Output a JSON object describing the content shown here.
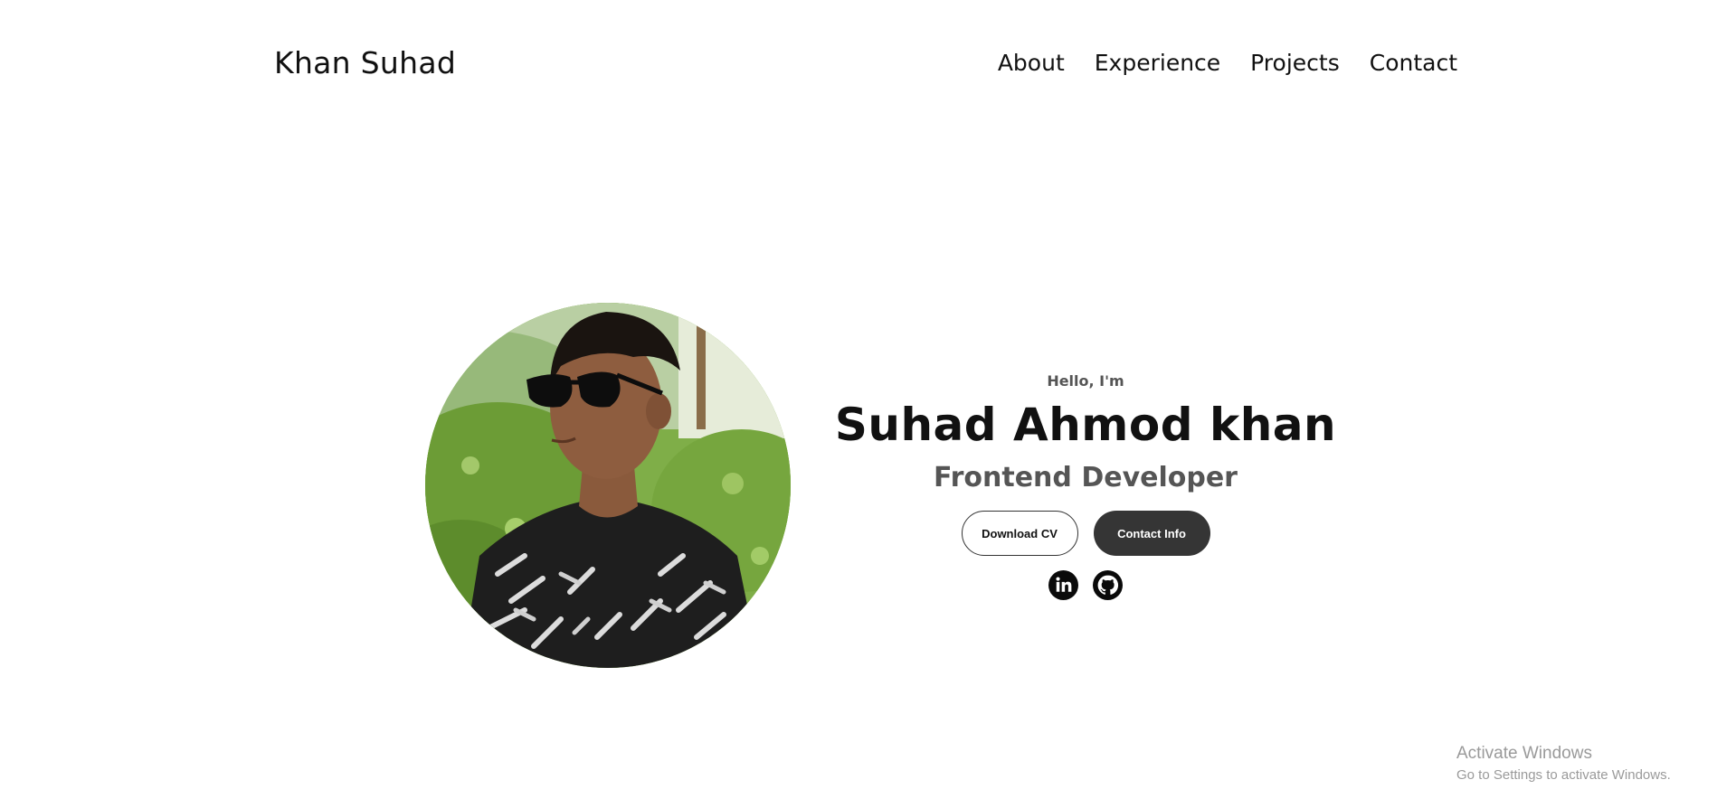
{
  "nav": {
    "logo": "Khan Suhad",
    "links": [
      "About",
      "Experience",
      "Projects",
      "Contact"
    ]
  },
  "hero": {
    "profile_image_alt": "Profile picture",
    "greeting": "Hello, I'm",
    "name": "Suhad Ahmod khan",
    "role": "Frontend Developer",
    "buttons": {
      "download_cv": "Download CV",
      "contact_info": "Contact Info"
    },
    "socials": [
      {
        "icon": "linkedin-icon"
      },
      {
        "icon": "github-icon"
      }
    ]
  },
  "watermark": {
    "title": "Activate Windows",
    "subtitle": "Go to Settings to activate Windows."
  },
  "colors": {
    "text": "#111111",
    "muted": "#555555",
    "button_dark": "#353535",
    "watermark": "#9a9a9a"
  }
}
